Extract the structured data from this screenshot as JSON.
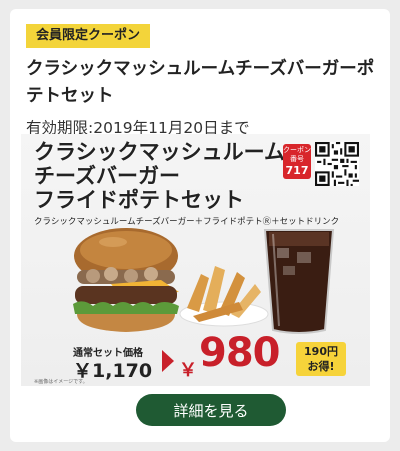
{
  "coupon": {
    "badge": "会員限定クーポン",
    "title": "クラシックマッシュルームチーズバーガーポテトセット",
    "expiry": "有効期限:2019年11月20日まで",
    "details_button": "詳細を見る"
  },
  "banner": {
    "title_line1": "クラシックマッシュルーム",
    "title_line2": "チーズバーガー",
    "title_line3": "フライドポテトセット",
    "subtitle": "クラシックマッシュルームチーズバーガー＋フライドポテトⓇ＋セットドリンク",
    "coupon_number_label": "クーポン番号",
    "coupon_number": "717",
    "regular_price_label": "通常セット価格",
    "regular_price": "￥1,170",
    "yen_symbol": "￥",
    "deal_price": "980",
    "savings_line1": "190円",
    "savings_line2": "お得!",
    "footnote": "※画像はイメージです。"
  },
  "colors": {
    "badge": "#f3d43a",
    "price_red": "#c8202a",
    "button_green": "#1f5a33",
    "coupon_red": "#d8262b"
  }
}
